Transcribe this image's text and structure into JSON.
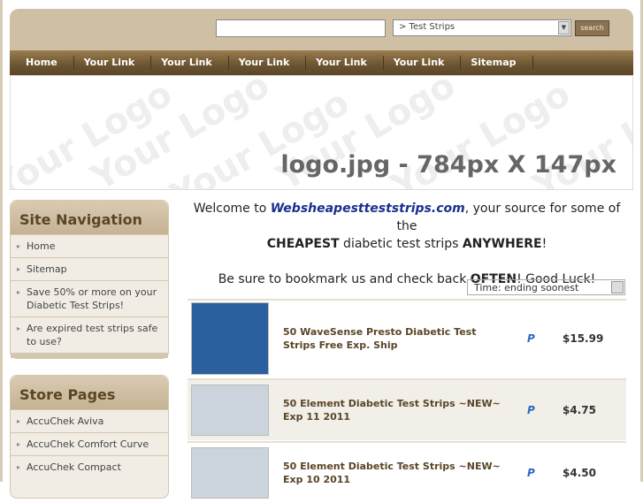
{
  "search": {
    "value": "",
    "category": "> Test Strips",
    "button": "search"
  },
  "nav": [
    "Home",
    "Your Link",
    "Your Link",
    "Your Link",
    "Your Link",
    "Your Link",
    "Sitemap"
  ],
  "logo": {
    "watermark": "Your Logo",
    "text": "logo.jpg - 784px X 147px"
  },
  "site_navigation": {
    "title": "Site Navigation",
    "items": [
      "Home",
      "Sitemap",
      "Save 50% or more on your Diabetic Test Strips!",
      "Are expired test strips safe to use?"
    ]
  },
  "store_pages": {
    "title": "Store Pages",
    "items": [
      "AccuChek Aviva",
      "AccuChek Comfort Curve",
      "AccuChek Compact"
    ]
  },
  "welcome": {
    "p1a": "Welcome to ",
    "site": "Websheapestteststrips.com",
    "p1b": ", your source for some of the ",
    "cheapest": "CHEAPEST",
    "p1c": " diabetic test strips ",
    "anywhere": "ANYWHERE",
    "p1d": "!",
    "p2a": "Be sure to bookmark us and check back ",
    "often": "OFTEN",
    "p2b": "! Good Luck!"
  },
  "sort": "Time: ending soonest",
  "listings": [
    {
      "title": "50 WaveSense Presto Diabetic Test Strips Free Exp. Ship",
      "price": "$15.99"
    },
    {
      "title": "50 Element Diabetic Test Strips ~NEW~ Exp 11 2011",
      "price": "$4.75"
    },
    {
      "title": "50 Element Diabetic Test Strips ~NEW~ Exp 10 2011",
      "price": "$4.50"
    }
  ]
}
